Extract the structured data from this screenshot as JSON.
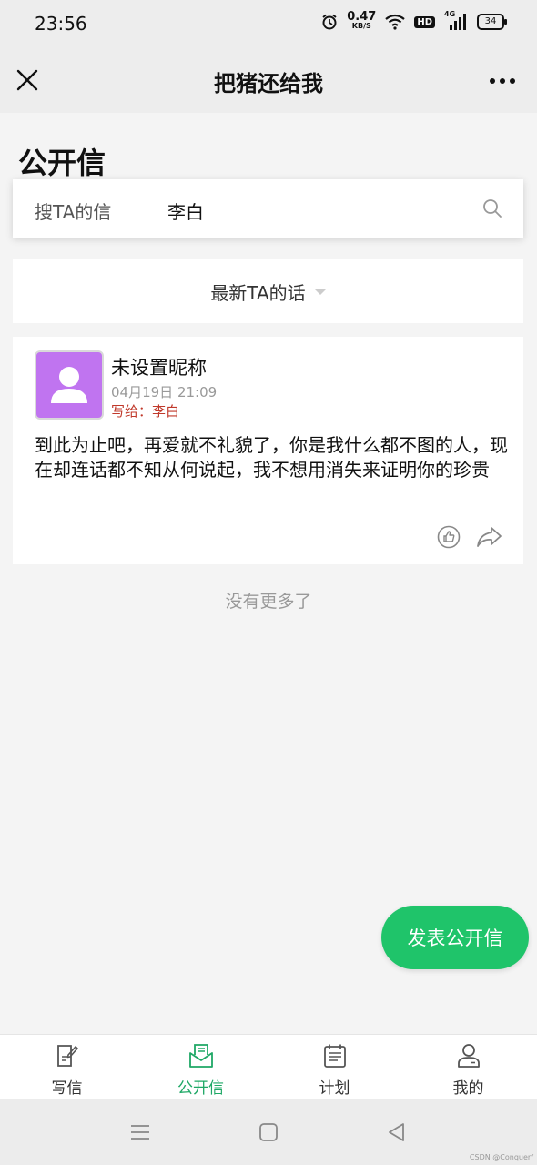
{
  "status_bar": {
    "time": "23:56",
    "speed_value": "0.47",
    "speed_unit": "KB/S",
    "hd": "HD",
    "network": "4G",
    "battery": "34"
  },
  "nav": {
    "title": "把猪还给我"
  },
  "page": {
    "heading": "公开信"
  },
  "search": {
    "label": "搜TA的信",
    "value": "李白"
  },
  "sort": {
    "label": "最新TA的话"
  },
  "letters": [
    {
      "author": "未设置昵称",
      "time": "04月19日 21:09",
      "recipient_label": "写给：",
      "recipient": "李白",
      "body": "到此为止吧，再爱就不礼貌了，你是我什么都不图的人，现在却连话都不知从何说起，我不想用消失来证明你的珍贵"
    }
  ],
  "no_more": "没有更多了",
  "publish_button": "发表公开信",
  "tabs": [
    {
      "label": "写信",
      "icon": "write-letter-icon"
    },
    {
      "label": "公开信",
      "icon": "open-letter-icon",
      "active": true
    },
    {
      "label": "计划",
      "icon": "plan-icon"
    },
    {
      "label": "我的",
      "icon": "profile-icon"
    }
  ],
  "colors": {
    "accent": "#1fc46a",
    "active_tab": "#1fa866",
    "recipient": "#c0392b",
    "avatar_bg": "#c074f0"
  },
  "watermark": "CSDN @Conquerf"
}
